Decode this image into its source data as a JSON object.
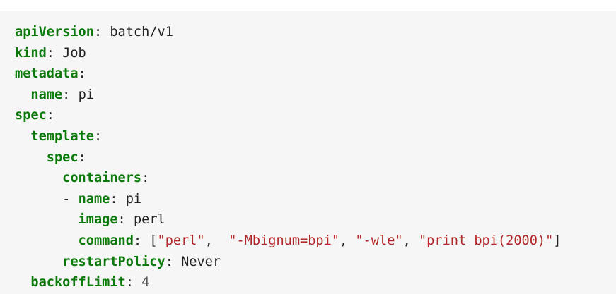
{
  "code": {
    "api_version_key": "apiVersion",
    "api_version_value": "batch/v1",
    "kind_key": "kind",
    "kind_value": "Job",
    "metadata_key": "metadata",
    "name_key": "name",
    "name_value": "pi",
    "spec_key": "spec",
    "template_key": "template",
    "inner_spec_key": "spec",
    "containers_key": "containers",
    "container_name_key": "name",
    "container_name_value": "pi",
    "image_key": "image",
    "image_value": "perl",
    "command_key": "command",
    "command_args": [
      "\"perl\"",
      "\"-Mbignum=bpi\"",
      "\"-wle\"",
      "\"print bpi(2000)\""
    ],
    "restart_policy_key": "restartPolicy",
    "restart_policy_value": "Never",
    "backoff_limit_key": "backoffLimit",
    "backoff_limit_value": "4"
  },
  "colors": {
    "key": "#0b7a0b",
    "string": "#b22727",
    "background": "#f6f6f6"
  }
}
